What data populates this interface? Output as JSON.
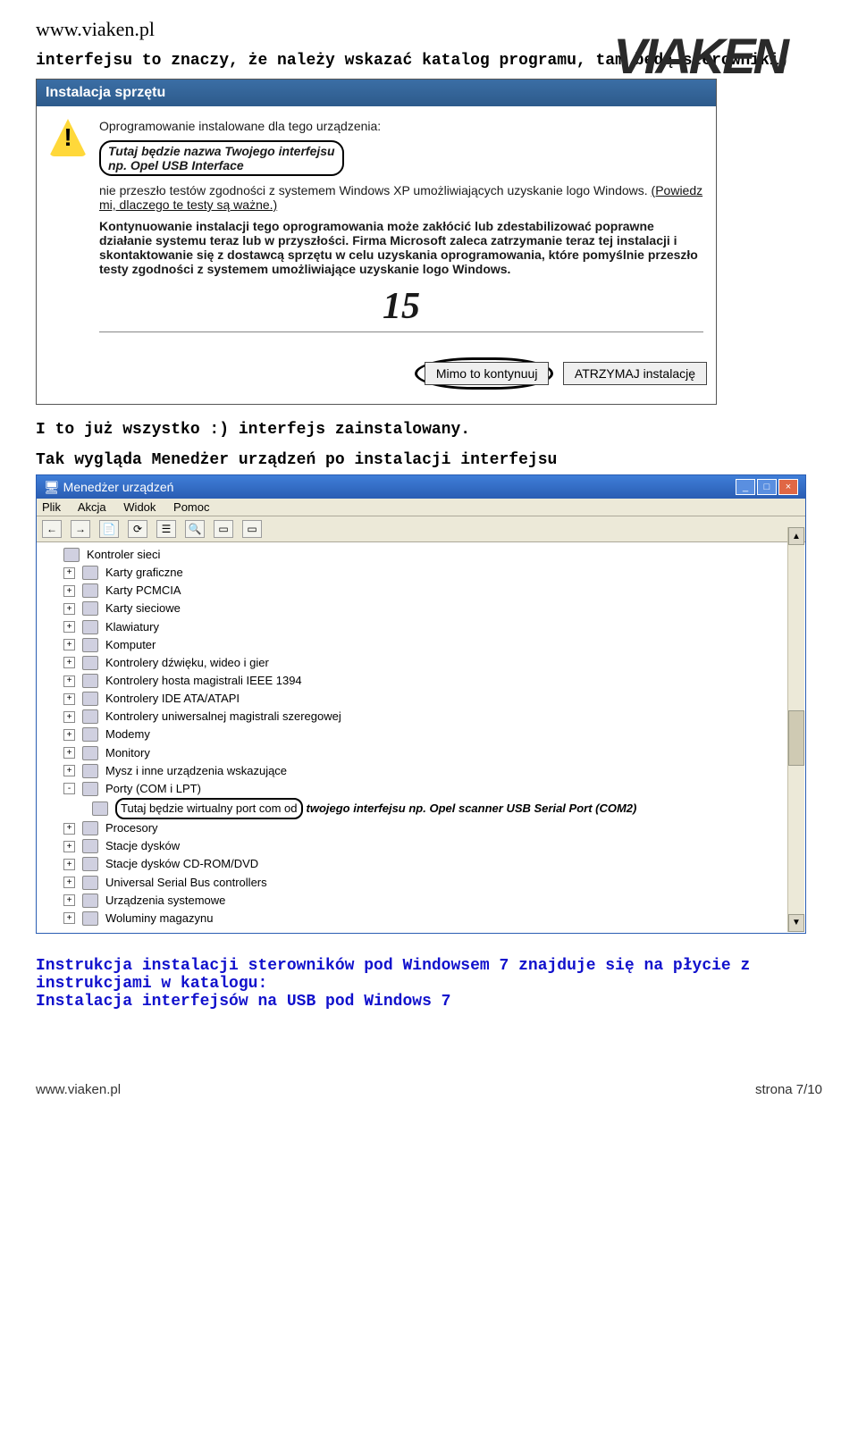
{
  "header": {
    "url": "www.viaken.pl",
    "logo_text": "VIAKEN"
  },
  "intro": "interfejsu to znaczy, że należy wskazać katalog programu, tam będą sterowniki)",
  "dialog1": {
    "title": "Instalacja sprzętu",
    "line1": "Oprogramowanie instalowane dla tego urządzenia:",
    "anno_line1": "Tutaj będzie nazwa Twojego interfejsu",
    "anno_line2": "np. Opel USB Interface",
    "line2": "nie przeszło testów zgodności z systemem Windows XP umożliwiających uzyskanie logo Windows. ",
    "link": "(Powiedz mi, dlaczego te testy są ważne.)",
    "para_bold": "Kontynuowanie instalacji tego oprogramowania może zakłócić lub zdestabilizować poprawne działanie systemu teraz lub w przyszłości. Firma Microsoft zaleca zatrzymanie teraz tej instalacji i skontaktowanie się z dostawcą sprzętu w celu uzyskania oprogramowania, które pomyślnie przeszło testy zgodności z systemem umożliwiające uzyskanie logo Windows.",
    "big_num": "15",
    "btn_continue": "Mimo to kontynuuj",
    "btn_stop": "ATRZYMAJ instalację"
  },
  "mid1": "I to już wszystko :) interfejs zainstalowany.",
  "mid2": "Tak wygląda Menedżer urządzeń po instalacji interfejsu",
  "dm": {
    "title": "Menedżer urządzeń",
    "menu": [
      "Plik",
      "Akcja",
      "Widok",
      "Pomoc"
    ],
    "items": [
      "Kontroler sieci",
      "Karty graficzne",
      "Karty PCMCIA",
      "Karty sieciowe",
      "Klawiatury",
      "Komputer",
      "Kontrolery dźwięku, wideo i gier",
      "Kontrolery hosta magistrali IEEE 1394",
      "Kontrolery IDE ATA/ATAPI",
      "Kontrolery uniwersalnej magistrali szeregowej",
      "Modemy",
      "Monitory",
      "Mysz i inne urządzenia wskazujące",
      "Porty (COM i LPT)",
      "Procesory",
      "Stacje dysków",
      "Stacje dysków CD-ROM/DVD",
      "Universal Serial Bus controllers",
      "Urządzenia systemowe",
      "Woluminy magazynu"
    ],
    "port_anno": "Tutaj będzie wirtualny port com od",
    "port_after": " twojego interfejsu np. Opel scanner USB Serial Port (COM2)"
  },
  "blue_instr": "Instrukcja instalacji sterowników pod Windowsem 7 znajduje się na płycie z instrukcjami w katalogu:\nInstalacja interfejsów na USB pod Windows 7",
  "footer": {
    "left": "www.viaken.pl",
    "right": "strona 7/10"
  }
}
